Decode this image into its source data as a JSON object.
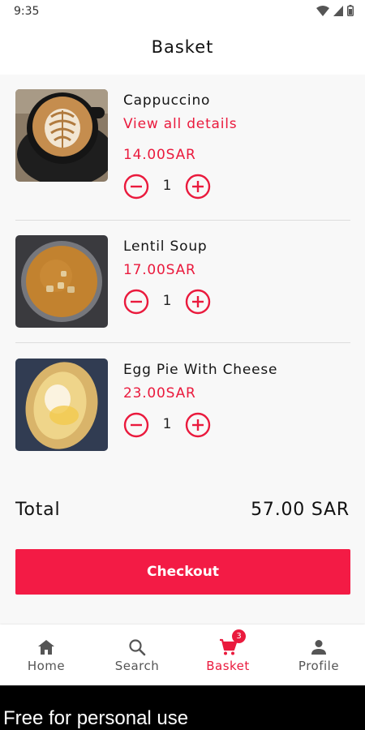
{
  "status_bar": {
    "time": "9:35"
  },
  "header": {
    "title": "Basket"
  },
  "items": [
    {
      "name": "Cappuccino",
      "link": "View all details",
      "price": "14.00SAR",
      "quantity": "1"
    },
    {
      "name": "Lentil Soup",
      "price": "17.00SAR",
      "quantity": "1"
    },
    {
      "name": "Egg Pie With Cheese",
      "price": "23.00SAR",
      "quantity": "1"
    }
  ],
  "summary": {
    "total_label": "Total",
    "total_value": "57.00 SAR"
  },
  "checkout_label": "Checkout",
  "nav": {
    "items": [
      {
        "label": "Home",
        "icon": "home-icon"
      },
      {
        "label": "Search",
        "icon": "search-icon"
      },
      {
        "label": "Basket",
        "icon": "cart-icon",
        "badge": "3",
        "active": true
      },
      {
        "label": "Profile",
        "icon": "person-icon"
      }
    ]
  },
  "watermark": "Free for personal use",
  "colors": {
    "accent": "#ea1a3d",
    "button": "#f31b45"
  }
}
